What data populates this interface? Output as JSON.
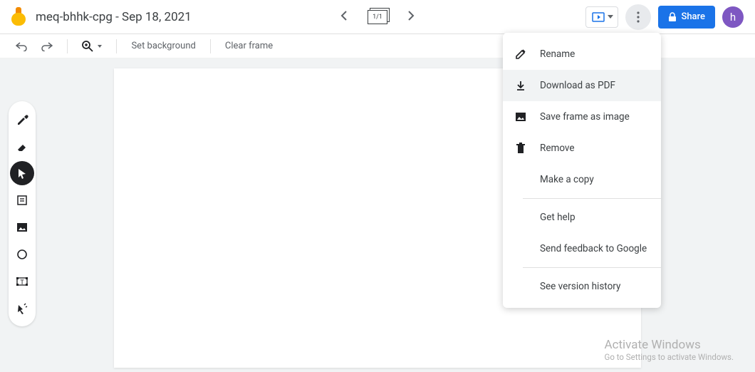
{
  "header": {
    "title": "meq-bhhk-cpg - Sep 18, 2021",
    "frame_indicator": "1/1",
    "share_label": "Share",
    "avatar_letter": "h"
  },
  "toolbar": {
    "set_background": "Set background",
    "clear_frame": "Clear frame"
  },
  "side_tools": [
    {
      "name": "eyedropper-tool",
      "active": false
    },
    {
      "name": "eraser-tool",
      "active": false
    },
    {
      "name": "pointer-tool",
      "active": true
    },
    {
      "name": "note-tool",
      "active": false
    },
    {
      "name": "image-tool",
      "active": false
    },
    {
      "name": "shape-tool",
      "active": false
    },
    {
      "name": "textbox-tool",
      "active": false
    },
    {
      "name": "laser-tool",
      "active": false
    }
  ],
  "menu": {
    "items": [
      {
        "label": "Rename",
        "icon": "edit-icon"
      },
      {
        "label": "Download as PDF",
        "icon": "download-icon",
        "hover": true
      },
      {
        "label": "Save frame as image",
        "icon": "image-icon"
      },
      {
        "label": "Remove",
        "icon": "trash-icon"
      },
      {
        "label": "Make a copy",
        "icon": ""
      }
    ],
    "group2": [
      {
        "label": "Get help"
      },
      {
        "label": "Send feedback to Google"
      }
    ],
    "group3": [
      {
        "label": "See version history"
      }
    ]
  },
  "watermark": {
    "line1": "Activate Windows",
    "line2": "Go to Settings to activate Windows."
  }
}
